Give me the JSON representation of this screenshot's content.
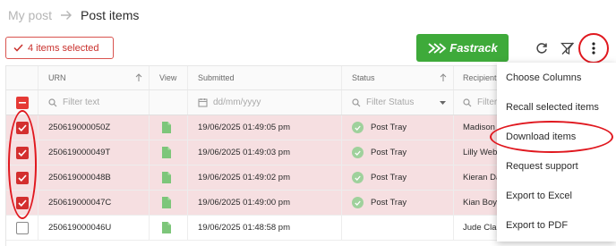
{
  "breadcrumb": {
    "parent": "My post",
    "current": "Post items"
  },
  "selection": {
    "label": "4 items selected"
  },
  "toolbar": {
    "fastrack_label": "Fastrack"
  },
  "colors": {
    "brand_green": "#3eaa3a",
    "selection_red": "#d32f2f",
    "row_selected": "#f6dfe1",
    "annotation_red": "#e0181f"
  },
  "icons": {
    "refresh": "refresh-icon",
    "filter_off": "filter-off-icon",
    "more": "more-vertical-icon",
    "document": "document-icon",
    "status": "check-circle-icon",
    "calendar": "calendar-icon",
    "search": "search-icon"
  },
  "table": {
    "columns": [
      {
        "key": "urn",
        "label": "URN",
        "filter_placeholder": "Filter text"
      },
      {
        "key": "view",
        "label": "View",
        "filter_placeholder": ""
      },
      {
        "key": "submitted",
        "label": "Submitted",
        "filter_placeholder": "dd/mm/yyyy"
      },
      {
        "key": "status",
        "label": "Status",
        "filter_placeholder": "Filter Status"
      },
      {
        "key": "recipient",
        "label": "Recipient",
        "filter_placeholder": "Filter"
      }
    ],
    "rows": [
      {
        "selected": true,
        "urn": "250619000050Z",
        "submitted": "19/06/2025 01:49:05 pm",
        "status": "Post Tray",
        "recipient": "Madison"
      },
      {
        "selected": true,
        "urn": "250619000049T",
        "submitted": "19/06/2025 01:49:03 pm",
        "status": "Post Tray",
        "recipient": "Lilly Web"
      },
      {
        "selected": true,
        "urn": "250619000048B",
        "submitted": "19/06/2025 01:49:02 pm",
        "status": "Post Tray",
        "recipient": "Kieran Da"
      },
      {
        "selected": true,
        "urn": "250619000047C",
        "submitted": "19/06/2025 01:49:00 pm",
        "status": "Post Tray",
        "recipient": "Kian Boyl"
      },
      {
        "selected": false,
        "urn": "250619000046U",
        "submitted": "19/06/2025 01:48:58 pm",
        "status": "",
        "recipient": "Jude Clar"
      }
    ]
  },
  "menu": {
    "items": [
      {
        "label": "Choose Columns"
      },
      {
        "label": "Recall selected items"
      },
      {
        "label": "Download items"
      },
      {
        "label": "Request support"
      },
      {
        "label": "Export to Excel"
      },
      {
        "label": "Export to PDF"
      }
    ]
  }
}
